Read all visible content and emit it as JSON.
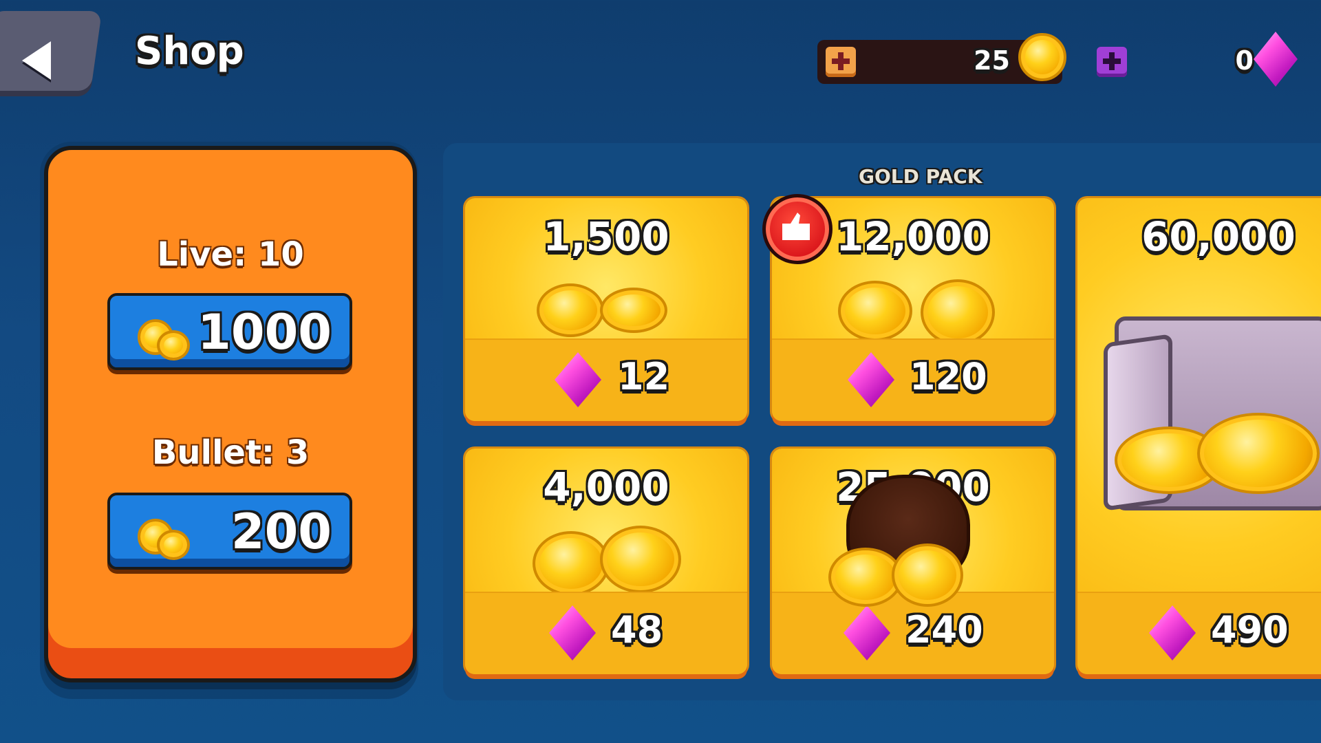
{
  "header": {
    "title": "Shop",
    "back_icon": "back-arrow-icon"
  },
  "currencies": {
    "gold": {
      "value": "25",
      "icon": "gold-coin-icon",
      "add_icon": "plus-icon",
      "color": "#f2a24a"
    },
    "gems": {
      "value": "0",
      "icon": "pink-gem-icon",
      "add_icon": "plus-icon",
      "color": "#a03fd6"
    }
  },
  "left_panel": {
    "color": "#ff8a1e",
    "items": [
      {
        "label": "Live: 10",
        "price": "1000",
        "icon": "gold-coins-icon"
      },
      {
        "label": "Bullet: 3",
        "price": "200",
        "icon": "gold-coins-icon"
      }
    ]
  },
  "gold_pack": {
    "heading": "GOLD PACK",
    "packs": [
      {
        "amount": "1,500",
        "gem_price": "12",
        "icon": "coin-pile-small-icon"
      },
      {
        "amount": "12,000",
        "gem_price": "120",
        "icon": "coin-pile-medium-icon",
        "badge": "thumbs-up-icon"
      },
      {
        "amount": "60,000",
        "gem_price": "490",
        "icon": "coin-safe-icon"
      },
      {
        "amount": "4,000",
        "gem_price": "48",
        "icon": "coin-pile-icon"
      },
      {
        "amount": "25,000",
        "gem_price": "240",
        "icon": "coin-bag-icon"
      }
    ]
  }
}
